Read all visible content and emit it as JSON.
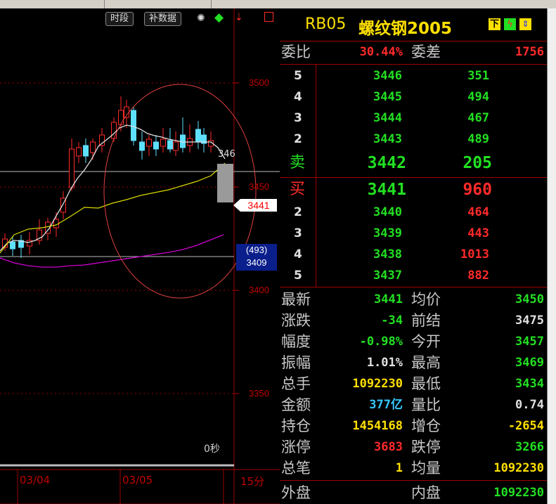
{
  "toolbar": {
    "period_button": "时段",
    "supplement_button": "补数据",
    "timeframe": "15分"
  },
  "chart": {
    "price_ticks": [
      "3500",
      "3450",
      "3400",
      "3350"
    ],
    "date_labels": [
      "03/04",
      "03/05"
    ],
    "seconds_label": "0秒",
    "current_price_tag": "3441",
    "partial_price_label": "346",
    "volume_tag": "(493)",
    "volume_price_tag": "3409"
  },
  "header": {
    "code": "RB05",
    "name": "螺纹钢2005",
    "btn_down": "下"
  },
  "ratio_row": {
    "label1": "委比",
    "value1": "30.44%",
    "label2": "委差",
    "value2": "1756"
  },
  "sell_side": {
    "label": "卖",
    "rows": [
      {
        "level": "5",
        "price": "3446",
        "vol": "351"
      },
      {
        "level": "4",
        "price": "3445",
        "vol": "494"
      },
      {
        "level": "3",
        "price": "3444",
        "vol": "467"
      },
      {
        "level": "2",
        "price": "3443",
        "vol": "489"
      },
      {
        "level": "",
        "price": "3442",
        "vol": "205"
      }
    ]
  },
  "buy_side": {
    "label": "买",
    "rows": [
      {
        "level": "",
        "price": "3441",
        "vol": "960"
      },
      {
        "level": "2",
        "price": "3440",
        "vol": "464"
      },
      {
        "level": "3",
        "price": "3439",
        "vol": "443"
      },
      {
        "level": "4",
        "price": "3438",
        "vol": "1013"
      },
      {
        "level": "5",
        "price": "3437",
        "vol": "882"
      }
    ]
  },
  "stats": [
    {
      "l1": "最新",
      "v1": "3441",
      "c1": "g",
      "l2": "均价",
      "v2": "3450",
      "c2": "g"
    },
    {
      "l1": "涨跌",
      "v1": "-34",
      "c1": "g",
      "l2": "前结",
      "v2": "3475",
      "c2": "w"
    },
    {
      "l1": "幅度",
      "v1": "-0.98%",
      "c1": "g",
      "l2": "今开",
      "v2": "3457",
      "c2": "g"
    },
    {
      "l1": "振幅",
      "v1": "1.01%",
      "c1": "w",
      "l2": "最高",
      "v2": "3469",
      "c2": "g"
    },
    {
      "l1": "总手",
      "v1": "1092230",
      "c1": "y",
      "l2": "最低",
      "v2": "3434",
      "c2": "g"
    },
    {
      "l1": "金额",
      "v1": "377亿",
      "c1": "c",
      "l2": "量比",
      "v2": "0.74",
      "c2": "w"
    },
    {
      "l1": "持仓",
      "v1": "1454168",
      "c1": "y",
      "l2": "增仓",
      "v2": "-2654",
      "c2": "y"
    },
    {
      "l1": "涨停",
      "v1": "3683",
      "c1": "r",
      "l2": "跌停",
      "v2": "3266",
      "c2": "g"
    },
    {
      "l1": "总笔",
      "v1": "1",
      "c1": "y",
      "l2": "均量",
      "v2": "1092230",
      "c2": "y"
    }
  ],
  "bottom": {
    "l1": "外盘",
    "v1": "",
    "l2": "内盘",
    "v2": "1092230"
  },
  "colors": {
    "up": "#ff2a2a",
    "down": "#22e022",
    "grid": "#a00000",
    "ma1": "#e0e0e0",
    "ma2": "#d8d800",
    "ma3": "#d000d0",
    "circle": "#e04040"
  }
}
